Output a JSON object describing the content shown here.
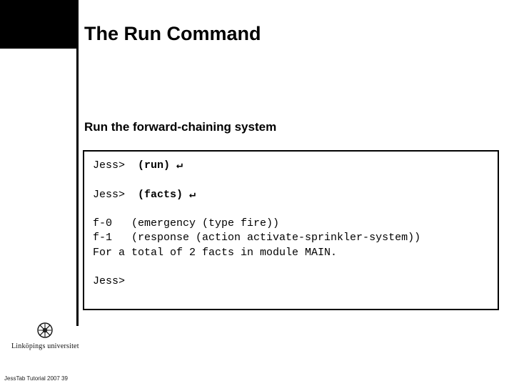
{
  "title": "The Run Command",
  "subtitle": "Run the forward-chaining system",
  "code": {
    "line1_prompt": "Jess>  ",
    "line1_cmd": "(run) ↵",
    "line2_prompt": "Jess>  ",
    "line2_cmd": "(facts) ↵",
    "out1": "f-0   (emergency (type fire))",
    "out2": "f-1   (response (action activate-sprinkler-system))",
    "out3": "For a total of 2 facts in module MAIN.",
    "line3_prompt": "Jess>"
  },
  "university": "Linköpings universitet",
  "footer": "JessTab Tutorial 2007",
  "page_number": "39"
}
